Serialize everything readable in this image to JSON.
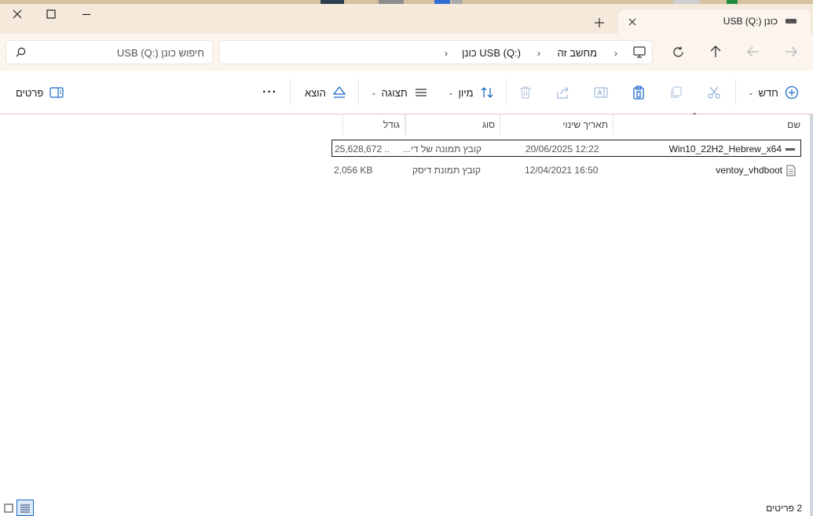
{
  "window": {
    "tab_title": "כונן USB (Q:)"
  },
  "navigation": {
    "breadcrumbs": [
      "מחשב זה",
      "כונן USB (Q:)"
    ],
    "search_placeholder": "חיפוש כונן USB (Q:)"
  },
  "toolbar": {
    "new_label": "חדש",
    "sort_label": "מיון",
    "view_label": "תצוגה",
    "eject_label": "הוצא",
    "details_label": "פרטים"
  },
  "columns": {
    "name": "שם",
    "date": "תאריך שינוי",
    "type": "סוג",
    "size": "גודל"
  },
  "files": [
    {
      "name": "Win10_22H2_Hebrew_x64",
      "date": "20/06/2025 12:22",
      "type": "קובץ תמונה של די...",
      "size": "25,628,672 ...",
      "icon": "disc-image-icon",
      "selected": true
    },
    {
      "name": "ventoy_vhdboot",
      "date": "12/04/2021 16:50",
      "type": "קובץ תמונת דיסק",
      "size": "2,056 KB",
      "icon": "document-icon",
      "selected": false
    }
  ],
  "status": {
    "item_count": "2 פריטים"
  },
  "colors": {
    "title_bar": "#f4e9da",
    "nav_bar": "#fbf5ee",
    "accent": "#1b6ac9"
  }
}
